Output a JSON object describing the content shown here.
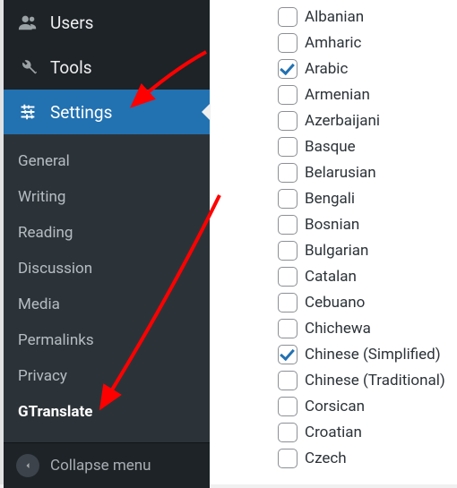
{
  "sidebar": {
    "top": [
      {
        "icon": "users",
        "label": "Users"
      },
      {
        "icon": "tools",
        "label": "Tools"
      }
    ],
    "active": {
      "icon": "settings",
      "label": "Settings"
    },
    "submenu": [
      {
        "label": "General",
        "current": false
      },
      {
        "label": "Writing",
        "current": false
      },
      {
        "label": "Reading",
        "current": false
      },
      {
        "label": "Discussion",
        "current": false
      },
      {
        "label": "Media",
        "current": false
      },
      {
        "label": "Permalinks",
        "current": false
      },
      {
        "label": "Privacy",
        "current": false
      },
      {
        "label": "GTranslate",
        "current": true
      }
    ],
    "collapse_label": "Collapse menu"
  },
  "languages": [
    {
      "label": "Albanian",
      "checked": false
    },
    {
      "label": "Amharic",
      "checked": false
    },
    {
      "label": "Arabic",
      "checked": true
    },
    {
      "label": "Armenian",
      "checked": false
    },
    {
      "label": "Azerbaijani",
      "checked": false
    },
    {
      "label": "Basque",
      "checked": false
    },
    {
      "label": "Belarusian",
      "checked": false
    },
    {
      "label": "Bengali",
      "checked": false
    },
    {
      "label": "Bosnian",
      "checked": false
    },
    {
      "label": "Bulgarian",
      "checked": false
    },
    {
      "label": "Catalan",
      "checked": false
    },
    {
      "label": "Cebuano",
      "checked": false
    },
    {
      "label": "Chichewa",
      "checked": false
    },
    {
      "label": "Chinese (Simplified)",
      "checked": true
    },
    {
      "label": "Chinese (Traditional)",
      "checked": false
    },
    {
      "label": "Corsican",
      "checked": false
    },
    {
      "label": "Croatian",
      "checked": false
    },
    {
      "label": "Czech",
      "checked": false
    }
  ],
  "annotations": {
    "arrow_color": "#ff0000"
  }
}
